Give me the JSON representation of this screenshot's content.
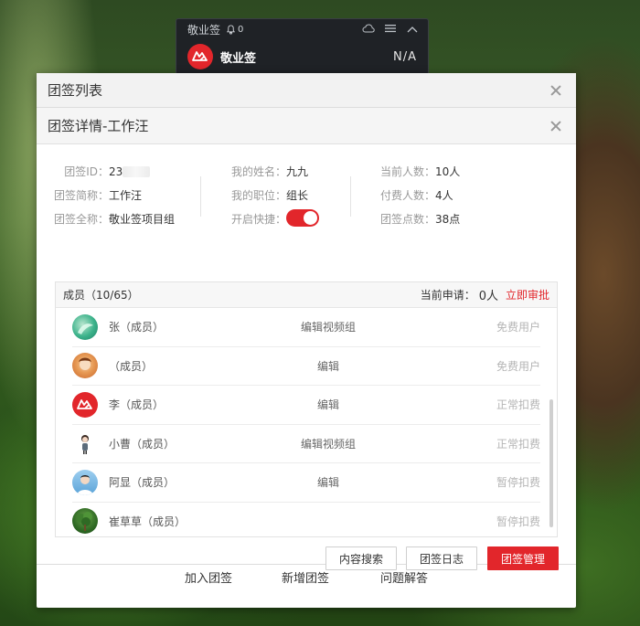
{
  "mini_widget": {
    "title": "敬业签",
    "bell_count": "0",
    "app_name": "敬业签",
    "value": "N/A"
  },
  "outer_dialog": {
    "title": "团签列表",
    "footer_links": [
      "加入团签",
      "新增团签",
      "问题解答"
    ]
  },
  "inner_dialog": {
    "title": "团签详情-工作汪",
    "info": {
      "col1": [
        {
          "key": "团签ID：",
          "value": "23"
        },
        {
          "key": "团签简称：",
          "value": "工作汪"
        },
        {
          "key": "团签全称：",
          "value": "敬业签项目组"
        }
      ],
      "col2": [
        {
          "key": "我的姓名：",
          "value": "九九"
        },
        {
          "key": "我的职位：",
          "value": "组长"
        },
        {
          "key": "开启快捷：",
          "value": ""
        }
      ],
      "col3": [
        {
          "key": "当前人数：",
          "value": "10人"
        },
        {
          "key": "付费人数：",
          "value": "4人"
        },
        {
          "key": "团签点数：",
          "value": "38点"
        }
      ]
    },
    "quick_toggle_on": true,
    "members": {
      "header": "成员（10/65）",
      "apply_label": "当前申请：",
      "apply_count": "0人",
      "apply_link": "立即审批",
      "rows": [
        {
          "name": "张（成员）",
          "role": "编辑视频组",
          "status": "免费用户",
          "avatar": "teal"
        },
        {
          "name": "（成员）",
          "role": "编辑",
          "status": "免费用户",
          "avatar": "orange"
        },
        {
          "name": "李（成员）",
          "role": "编辑",
          "status": "正常扣费",
          "avatar": "logo"
        },
        {
          "name": "小曹（成员）",
          "role": "编辑视频组",
          "status": "正常扣费",
          "avatar": "girl"
        },
        {
          "name": "阿显（成员）",
          "role": "编辑",
          "status": "暂停扣费",
          "avatar": "blue"
        },
        {
          "name": "崔草草（成员）",
          "role": "",
          "status": "暂停扣费",
          "avatar": "tree"
        }
      ]
    },
    "buttons": {
      "search": "内容搜索",
      "log": "团签日志",
      "manage": "团签管理"
    }
  },
  "colors": {
    "brand_red": "#e2262b"
  }
}
